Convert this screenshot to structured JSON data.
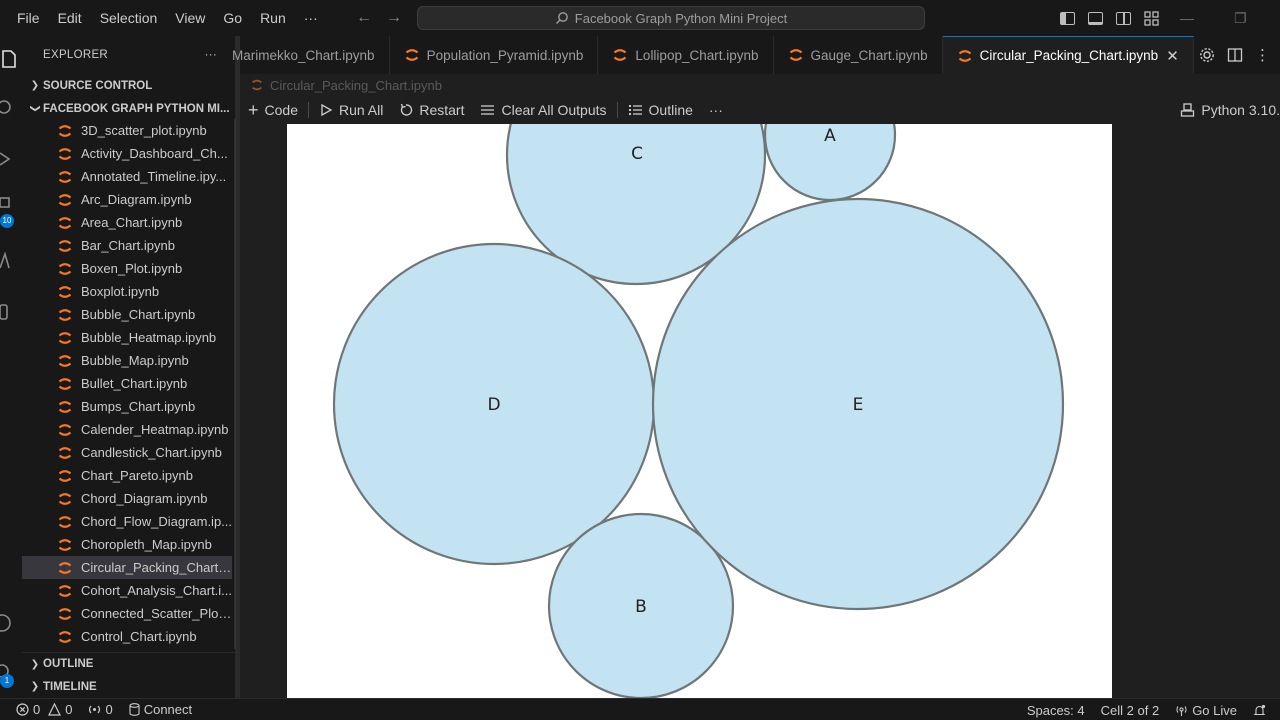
{
  "menu": [
    "File",
    "Edit",
    "Selection",
    "View",
    "Go",
    "Run",
    "···"
  ],
  "search": {
    "text": "Facebook Graph Python Mini Project"
  },
  "activity": {
    "scm_badge": "10",
    "accounts_badge": "1"
  },
  "explorer": {
    "title": "EXPLORER",
    "more": "···",
    "source_control": "SOURCE CONTROL",
    "project": "FACEBOOK GRAPH PYTHON MI...",
    "files": [
      "3D_scatter_plot.ipynb",
      "Activity_Dashboard_Ch...",
      "Annotated_Timeline.ipy...",
      "Arc_Diagram.ipynb",
      "Area_Chart.ipynb",
      "Bar_Chart.ipynb",
      "Boxen_Plot.ipynb",
      "Boxplot.ipynb",
      "Bubble_Chart.ipynb",
      "Bubble_Heatmap.ipynb",
      "Bubble_Map.ipynb",
      "Bullet_Chart.ipynb",
      "Bumps_Chart.ipynb",
      "Calender_Heatmap.ipynb",
      "Candlestick_Chart.ipynb",
      "Chart_Pareto.ipynb",
      "Chord_Diagram.ipynb",
      "Chord_Flow_Diagram.ip...",
      "Choropleth_Map.ipynb",
      "Circular_Packing_Chart.i...",
      "Cohort_Analysis_Chart.i...",
      "Connected_Scatter_Plot...",
      "Control_Chart.ipynb"
    ],
    "active_index": 19,
    "outline": "OUTLINE",
    "timeline": "TIMELINE"
  },
  "tabs": [
    {
      "label": "Marimekko_Chart.ipynb"
    },
    {
      "label": "Population_Pyramid.ipynb"
    },
    {
      "label": "Lollipop_Chart.ipynb"
    },
    {
      "label": "Gauge_Chart.ipynb"
    },
    {
      "label": "Circular_Packing_Chart.ipynb",
      "active": true
    }
  ],
  "breadcrumb": "Circular_Packing_Chart.ipynb",
  "toolbar": {
    "code": "Code",
    "run_all": "Run All",
    "restart": "Restart",
    "clear": "Clear All Outputs",
    "outline": "Outline",
    "more": "···",
    "kernel": "Python 3.10."
  },
  "chart_data": {
    "type": "circle-packing",
    "circles": [
      {
        "label": "A"
      },
      {
        "label": "B"
      },
      {
        "label": "C"
      },
      {
        "label": "D"
      },
      {
        "label": "E"
      }
    ],
    "fill": "#c3e3f2",
    "stroke": "#6e7678"
  },
  "status": {
    "errors": "0",
    "warnings": "0",
    "ports": "0",
    "connect": "Connect",
    "spaces": "Spaces: 4",
    "cell": "Cell 2 of 2",
    "golive": "Go Live"
  },
  "colors": {
    "accent": "#0078d4",
    "notebook_icon": "#f37726"
  }
}
